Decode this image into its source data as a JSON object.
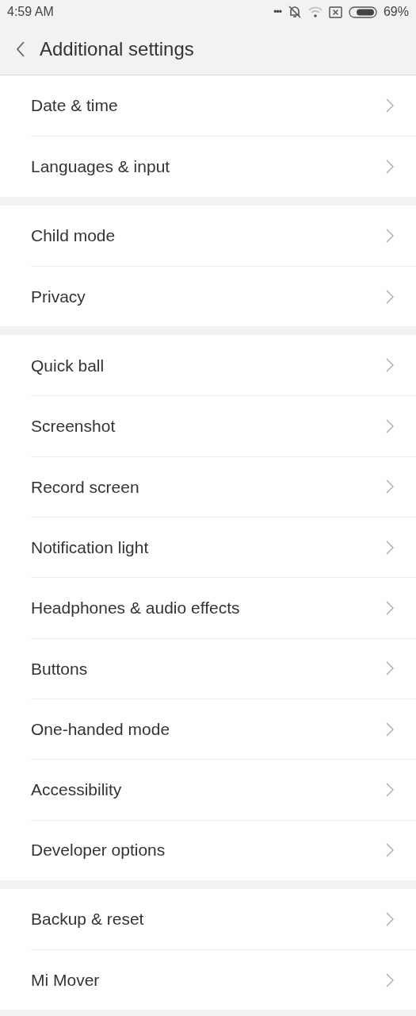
{
  "status_bar": {
    "time": "4:59 AM",
    "more": "•••",
    "battery_text": "69%"
  },
  "header": {
    "title": "Additional settings"
  },
  "groups": [
    {
      "items": [
        {
          "label": "Date & time"
        },
        {
          "label": "Languages & input"
        }
      ]
    },
    {
      "items": [
        {
          "label": "Child mode"
        },
        {
          "label": "Privacy"
        }
      ]
    },
    {
      "items": [
        {
          "label": "Quick ball"
        },
        {
          "label": "Screenshot"
        },
        {
          "label": "Record screen"
        },
        {
          "label": "Notification light"
        },
        {
          "label": "Headphones & audio effects"
        },
        {
          "label": "Buttons"
        },
        {
          "label": "One-handed mode"
        },
        {
          "label": "Accessibility"
        },
        {
          "label": "Developer options"
        }
      ]
    },
    {
      "items": [
        {
          "label": "Backup & reset"
        },
        {
          "label": "Mi Mover"
        }
      ]
    }
  ]
}
